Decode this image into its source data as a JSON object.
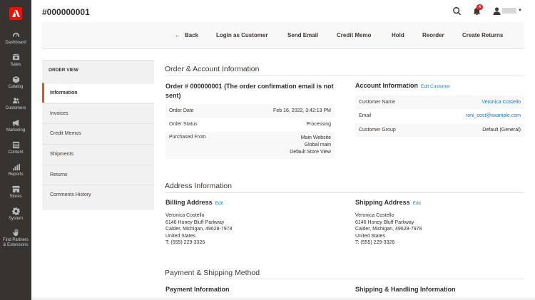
{
  "header": {
    "page_title": "#000000001",
    "notification_count": "4"
  },
  "sidebar": {
    "items": [
      {
        "label": "Dashboard",
        "icon": "dashboard-icon"
      },
      {
        "label": "Sales",
        "icon": "sales-icon"
      },
      {
        "label": "Catalog",
        "icon": "catalog-icon"
      },
      {
        "label": "Customers",
        "icon": "customers-icon"
      },
      {
        "label": "Marketing",
        "icon": "marketing-icon"
      },
      {
        "label": "Content",
        "icon": "content-icon"
      },
      {
        "label": "Reports",
        "icon": "reports-icon"
      },
      {
        "label": "Stores",
        "icon": "stores-icon"
      },
      {
        "label": "System",
        "icon": "system-icon"
      },
      {
        "label_line1": "Find Partners",
        "label_line2": "& Extensions",
        "icon": "partners-icon"
      }
    ]
  },
  "toolbar": {
    "back": "Back",
    "login_as_customer": "Login as Customer",
    "send_email": "Send Email",
    "credit_memo": "Credit Memo",
    "hold": "Hold",
    "reorder": "Reorder",
    "create_returns": "Create Returns"
  },
  "tabs": {
    "title": "ORDER VIEW",
    "items": [
      "Information",
      "Invoices",
      "Credit Memos",
      "Shipments",
      "Returns",
      "Comments History"
    ]
  },
  "order_account": {
    "section_title": "Order & Account Information",
    "order_heading": "Order # 000000001 (The order confirmation email is not sent)",
    "order_rows": [
      {
        "label": "Order Date",
        "value": "Feb 16, 2022, 3:42:13 PM"
      },
      {
        "label": "Order Status",
        "value": "Processing"
      },
      {
        "label": "Purchased From",
        "value_lines": [
          "Main Website",
          "Global main",
          "Default Store View"
        ]
      }
    ],
    "account_heading": "Account Information",
    "edit_customer": "Edit Customer",
    "account_rows": [
      {
        "label": "Customer Name",
        "value": "Veronica Costello"
      },
      {
        "label": "Email",
        "value": "roni_cost@example.com"
      },
      {
        "label": "Customer Group",
        "value": "Default (General)"
      }
    ]
  },
  "address": {
    "section_title": "Address Information",
    "billing_heading": "Billing Address",
    "shipping_heading": "Shipping Address",
    "edit_label": "Edit",
    "billing_lines": [
      "Veronica Costello",
      "6146 Honey Bluff Parkway",
      "Calder, Michigan, 49628-7978",
      "United States",
      "T: (555) 229-3326"
    ],
    "shipping_lines": [
      "Veronica Costello",
      "6146 Honey Bluff Parkway",
      "Calder, Michigan, 49628-7978",
      "United States",
      "T: (555) 229-3326"
    ]
  },
  "payment_shipping": {
    "section_title": "Payment & Shipping Method",
    "payment_heading": "Payment Information",
    "shipping_heading": "Shipping & Handling Information"
  },
  "colors": {
    "sidebar_bg": "#373330",
    "accent": "#eb5202",
    "link": "#1979c3",
    "badge": "#e22626",
    "logo": "#eb1000"
  }
}
